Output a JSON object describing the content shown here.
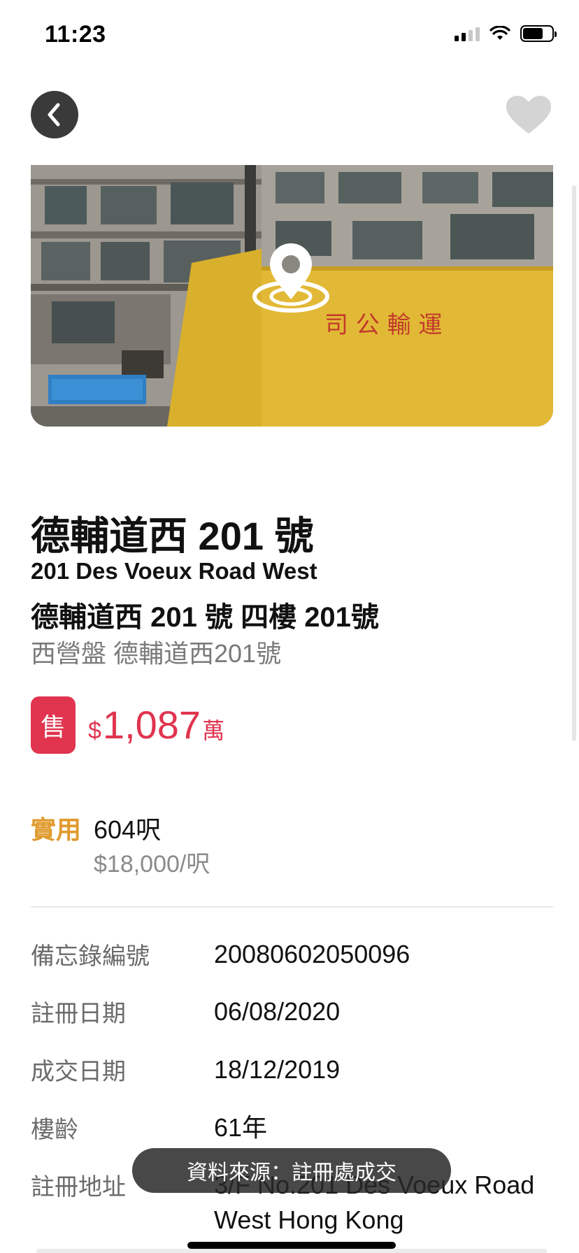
{
  "status_bar": {
    "time": "11:23"
  },
  "colors": {
    "accent_red": "#e0344f",
    "accent_orange": "#e09a2e",
    "muted": "#7a7a7a"
  },
  "icons": {
    "back": "chevron-left-icon",
    "favorite": "heart-icon",
    "location": "map-pin-icon"
  },
  "property": {
    "title_zh": "德輔道西 201 號",
    "title_en": "201 Des Voeux Road West",
    "unit_zh": "德輔道西 201 號 四樓 201號",
    "area_zh": "西營盤 德輔道西201號"
  },
  "price": {
    "badge": "售",
    "currency": "$",
    "amount": "1,087",
    "unit": "萬"
  },
  "area": {
    "label": "實用",
    "value": "604呎",
    "price_per_sqft": "$18,000/呎"
  },
  "details": [
    {
      "label": "備忘錄編號",
      "value": "20080602050096"
    },
    {
      "label": "註冊日期",
      "value": "06/08/2020"
    },
    {
      "label": "成交日期",
      "value": "18/12/2019"
    },
    {
      "label": "樓齡",
      "value": "61年"
    },
    {
      "label": "註冊地址",
      "value": "3/F No.201 Des Voeux Road West Hong Kong"
    }
  ],
  "toast": {
    "text": "資料來源：註冊處成交"
  }
}
